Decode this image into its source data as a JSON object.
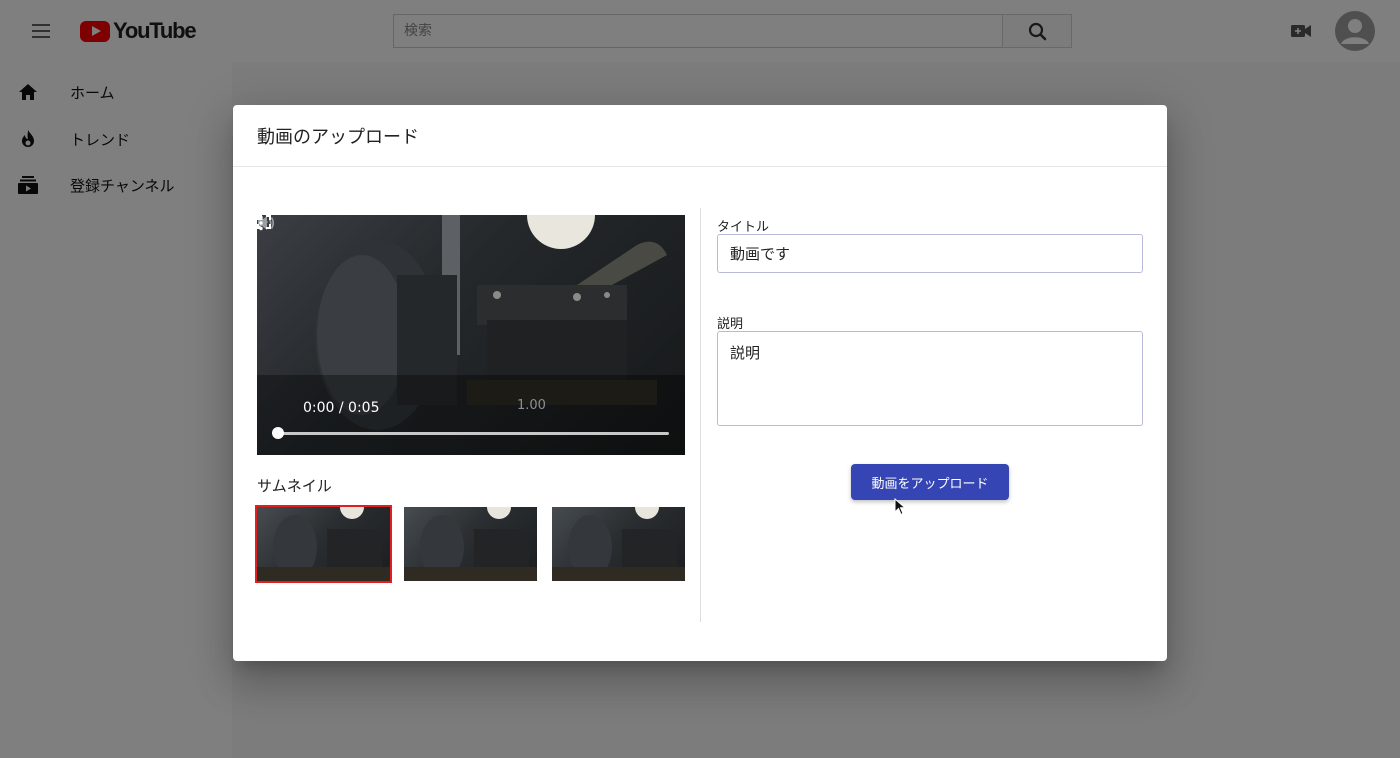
{
  "app": {
    "logo_text": "YouTube",
    "search_placeholder": "検索"
  },
  "sidebar": {
    "items": [
      {
        "label": "ホーム",
        "icon": "home-icon"
      },
      {
        "label": "トレンド",
        "icon": "flame-icon"
      },
      {
        "label": "登録チャンネル",
        "icon": "subscriptions-icon"
      }
    ]
  },
  "dialog": {
    "title": "動画のアップロード",
    "video": {
      "time": "0:00 / 0:05",
      "speed": "1.00",
      "progress": 0
    },
    "thumbnail_label": "サムネイル",
    "thumbnails": [
      {
        "selected": true
      },
      {
        "selected": false
      },
      {
        "selected": false
      }
    ],
    "title_field": {
      "label": "タイトル",
      "value": "動画です"
    },
    "description_field": {
      "label": "説明",
      "value": "説明"
    },
    "upload_button": "動画をアップロード"
  },
  "colors": {
    "brand_red": "#ff0000",
    "primary_button": "#3545b3",
    "selected_thumbnail_border": "#e02020"
  }
}
